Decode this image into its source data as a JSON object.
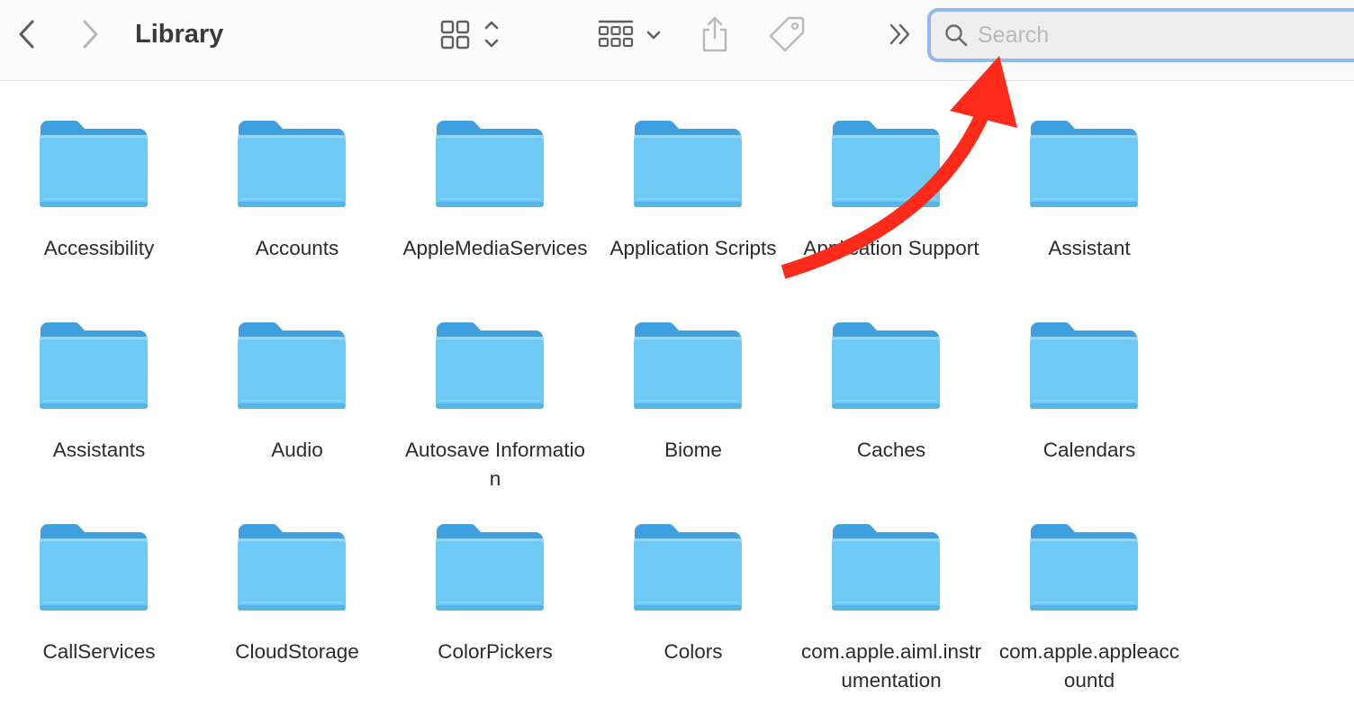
{
  "window": {
    "title": "Library"
  },
  "toolbar": {
    "back_icon": "chevron-left-icon",
    "forward_icon": "chevron-right-icon",
    "view_icon": "icon-grid-view-icon",
    "group_icon": "group-by-icon",
    "share_icon": "share-icon",
    "tag_icon": "tag-icon",
    "more_icon": "double-chevron-right-icon"
  },
  "search": {
    "placeholder": "Search",
    "value": "",
    "icon": "search-icon",
    "border_color": "#8fb9f0"
  },
  "folder_colors": {
    "body": "#6fcaf6",
    "tab": "#3ea0de"
  },
  "annotation": {
    "arrow_color": "#ff2a1a"
  },
  "items": [
    {
      "name": "Accessibility"
    },
    {
      "name": "Accounts"
    },
    {
      "name": "AppleMediaServices"
    },
    {
      "name": "Application Scripts"
    },
    {
      "name": "Application Support"
    },
    {
      "name": "Assistant"
    },
    {
      "name": "Assistants"
    },
    {
      "name": "Audio"
    },
    {
      "name": "Autosave Information"
    },
    {
      "name": "Biome"
    },
    {
      "name": "Caches"
    },
    {
      "name": "Calendars"
    },
    {
      "name": "CallServices"
    },
    {
      "name": "CloudStorage"
    },
    {
      "name": "ColorPickers"
    },
    {
      "name": "Colors"
    },
    {
      "name": "com.apple.aiml.instrumentation"
    },
    {
      "name": "com.apple.appleaccountd"
    }
  ]
}
